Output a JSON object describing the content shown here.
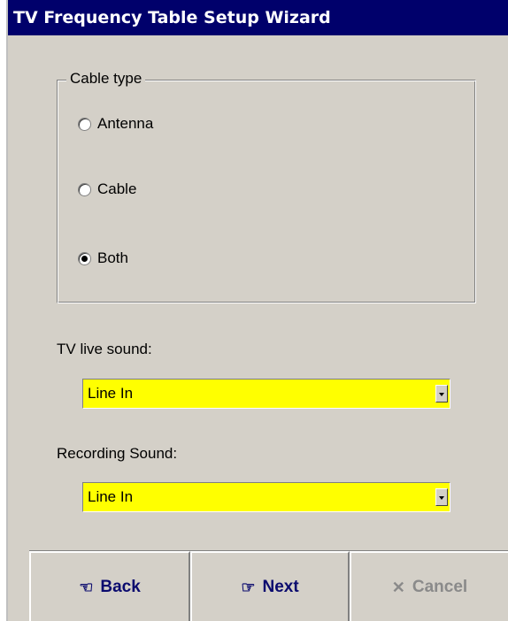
{
  "window": {
    "title": "TV Frequency Table Setup Wizard"
  },
  "cable_type": {
    "legend": "Cable type",
    "options": [
      {
        "label": "Antenna",
        "checked": false
      },
      {
        "label": "Cable",
        "checked": false
      },
      {
        "label": "Both",
        "checked": true
      }
    ]
  },
  "tv_live_sound": {
    "label": "TV live sound:",
    "value": "Line In"
  },
  "recording_sound": {
    "label": "Recording Sound:",
    "value": "Line In"
  },
  "buttons": {
    "back": {
      "label": "Back",
      "icon": "back-hand-icon",
      "enabled": true
    },
    "next": {
      "label": "Next",
      "icon": "pointing-hand-icon",
      "enabled": true
    },
    "cancel": {
      "label": "Cancel",
      "icon": "x-icon",
      "enabled": false
    }
  },
  "colors": {
    "titlebar": "#00006b",
    "combo_background": "#ffff00",
    "dialog_background": "#d4d0c8",
    "button_text": "#0a0a6e",
    "disabled_text": "#8a8a8a"
  }
}
